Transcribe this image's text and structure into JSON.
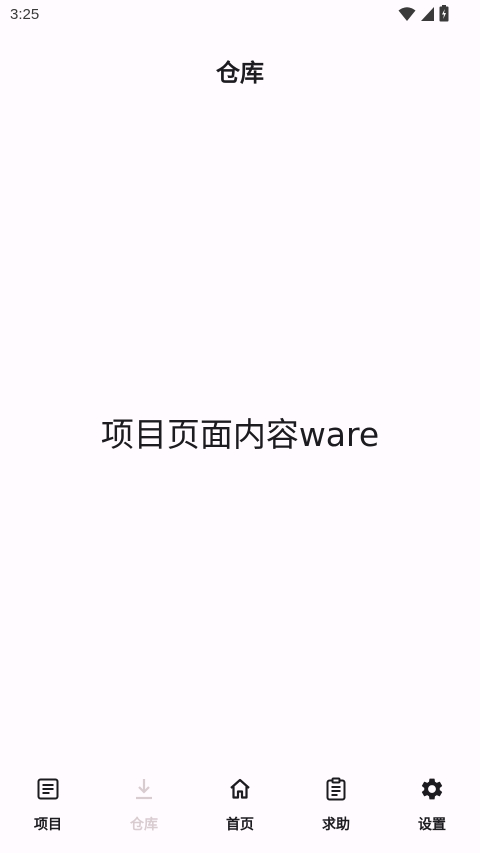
{
  "status_bar": {
    "time": "3:25",
    "icons": [
      "wifi-icon",
      "signal-icon",
      "battery-icon"
    ]
  },
  "app_bar": {
    "title": "仓库"
  },
  "content": {
    "text": "项目页面内容ware"
  },
  "bottom_nav": {
    "items": [
      {
        "label": "项目",
        "icon": "document-icon",
        "active": false
      },
      {
        "label": "仓库",
        "icon": "download-icon",
        "active": true
      },
      {
        "label": "首页",
        "icon": "home-icon",
        "active": false
      },
      {
        "label": "求助",
        "icon": "clipboard-icon",
        "active": false
      },
      {
        "label": "设置",
        "icon": "gear-icon",
        "active": false
      }
    ]
  },
  "colors": {
    "background": "#fffbfe",
    "text": "#1c1b1f",
    "inactive_selected": "#d9ccd1"
  }
}
